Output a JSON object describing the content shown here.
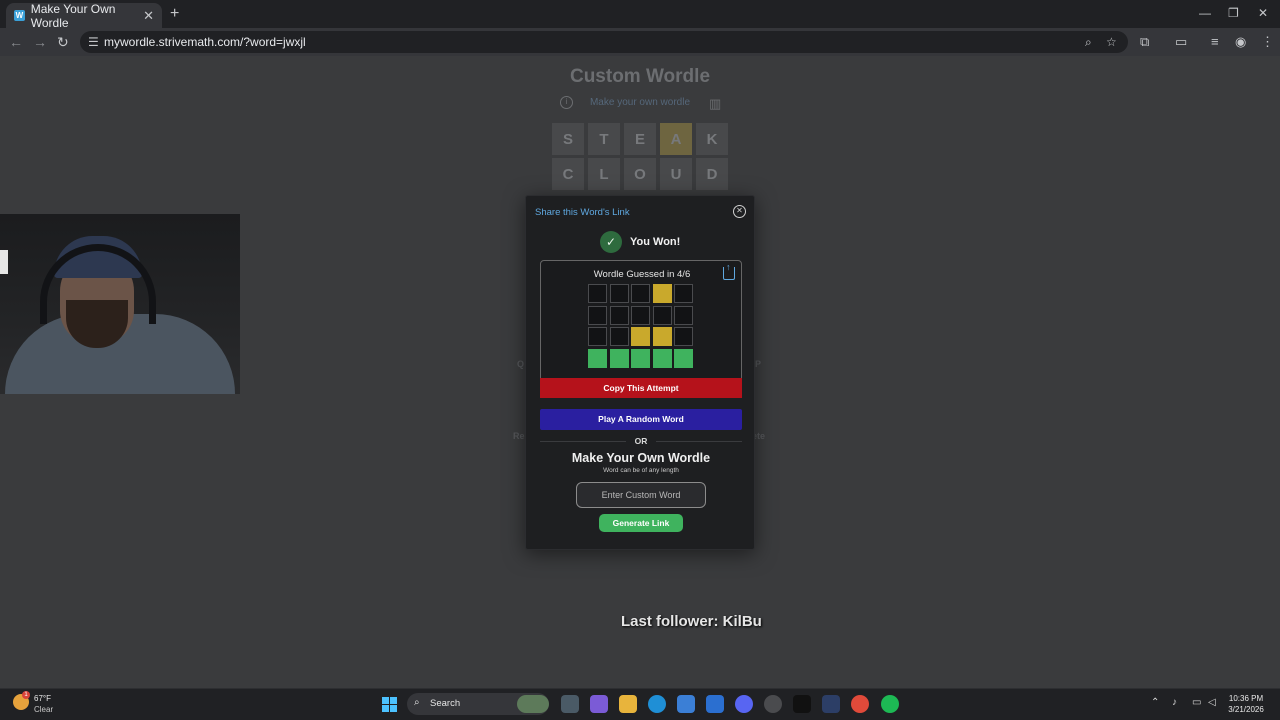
{
  "browser": {
    "tab_title": "Make Your Own Wordle",
    "tab_close": "✕",
    "new_tab": "+",
    "url": "mywordle.strivemath.com/?word=jwxjl",
    "window_controls": [
      "—",
      "❐",
      "✕"
    ]
  },
  "game": {
    "title": "Custom Wordle",
    "subtitle": "Make your own wordle",
    "board": [
      {
        "letters": [
          "S",
          "T",
          "E",
          "A",
          "K"
        ],
        "states": [
          "absent",
          "absent",
          "absent",
          "present",
          "absent"
        ]
      },
      {
        "letters": [
          "C",
          "L",
          "O",
          "U",
          "D"
        ],
        "states": [
          "absent",
          "absent",
          "absent",
          "absent",
          "absent"
        ]
      }
    ],
    "background_keys": [
      "Q",
      "P",
      "Re",
      "ete"
    ]
  },
  "modal": {
    "title": "Share this Word's Link",
    "close_icon": "⊗",
    "won_text": "You Won!",
    "result_title": "Wordle Guessed in 4/6",
    "grid": [
      [
        "empty",
        "empty",
        "empty",
        "yellow",
        "empty"
      ],
      [
        "empty",
        "empty",
        "empty",
        "empty",
        "empty"
      ],
      [
        "empty",
        "empty",
        "yellow",
        "yellow",
        "empty"
      ],
      [
        "green",
        "green",
        "green",
        "green",
        "green"
      ]
    ],
    "copy_button": "Copy This Attempt",
    "random_button": "Play A Random Word",
    "or_text": "OR",
    "make_title": "Make Your Own Wordle",
    "make_subtitle": "Word can be of any length",
    "input_placeholder": "Enter Custom Word",
    "generate_button": "Generate Link"
  },
  "overlay": {
    "follower_text": "Last follower: KilBu"
  },
  "taskbar": {
    "weather_temp": "67°F",
    "weather_cond": "Clear",
    "weather_badge": "1",
    "search_label": "Search",
    "time": "10:36 PM",
    "date": "3/21/2026"
  },
  "colors": {
    "present": "#c9a92c",
    "correct": "#3fb35e",
    "copy_button": "#b5121b",
    "random_button": "#2a1fa0",
    "link": "#5fa8e0"
  }
}
